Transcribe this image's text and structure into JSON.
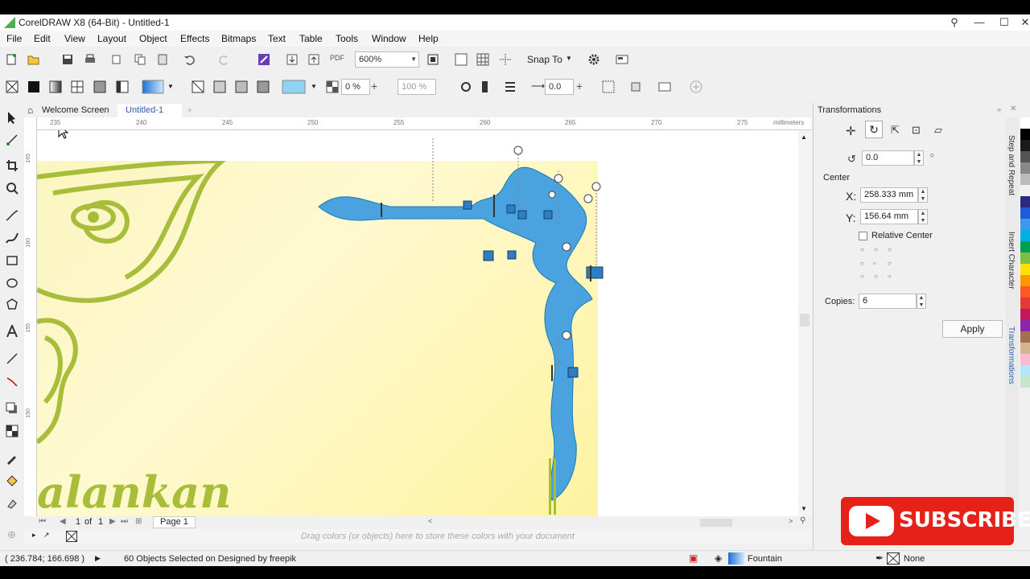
{
  "window": {
    "title": "CorelDRAW X8 (64-Bit) - Untitled-1",
    "min_glyph": "—",
    "max_glyph": "☐",
    "close_glyph": "✕"
  },
  "menu": [
    "File",
    "Edit",
    "View",
    "Layout",
    "Object",
    "Effects",
    "Bitmaps",
    "Text",
    "Table",
    "Tools",
    "Window",
    "Help"
  ],
  "toolbar": {
    "zoom": "600%",
    "snap_to": "Snap To",
    "pdf_label": "PDF"
  },
  "property_bar": {
    "transparency_percent": "0 %",
    "opacity_percent": "100 %",
    "offset": "0.0"
  },
  "tabs": {
    "welcome": "Welcome Screen",
    "doc": "Untitled-1",
    "add": "+"
  },
  "ruler": {
    "ticks": [
      "235",
      "240",
      "245",
      "250",
      "255",
      "260",
      "265",
      "270",
      "275"
    ],
    "units": "millimeters",
    "v_ticks": [
      "165",
      "160",
      "155",
      "150"
    ]
  },
  "canvas": {
    "ornament_text": "alankan"
  },
  "page_nav": {
    "current": "1",
    "of_label": "of",
    "total": "1",
    "page_tab": "Page 1"
  },
  "colorbar": {
    "hint": "Drag colors (or objects) here to store these colors with your document"
  },
  "status": {
    "coords": "( 236.784; 166.698 )",
    "selection": "60 Objects Selected on Designed by freepik",
    "fill": "Fountain",
    "outline": "None"
  },
  "docker": {
    "title": "Transformations",
    "angle": "0.0",
    "center_label": "Center",
    "x_label": "X:",
    "x_value": "258.333 mm",
    "y_label": "Y:",
    "y_value": "156.64 mm",
    "relative_center": "Relative Center",
    "copies_label": "Copies:",
    "copies_value": "6",
    "apply": "Apply"
  },
  "side_tabs": [
    "Step and Repeat",
    "Insert Character",
    "Transformations"
  ],
  "palette_colors": [
    "#ffffff",
    "#000000",
    "#1a1a1a",
    "#555555",
    "#888888",
    "#bbbbbb",
    "#f0f0f0",
    "#2a2a80",
    "#1e5bd8",
    "#3b9af0",
    "#00b0e0",
    "#00a050",
    "#7bc043",
    "#ffe000",
    "#ff9800",
    "#ff5722",
    "#e53935",
    "#c2185b",
    "#8e24aa",
    "#a07050",
    "#d4b48c",
    "#f8bbd0",
    "#b3e5fc",
    "#c8e6c9"
  ],
  "overlay": {
    "subscribe": "SUBSCRIBE"
  }
}
